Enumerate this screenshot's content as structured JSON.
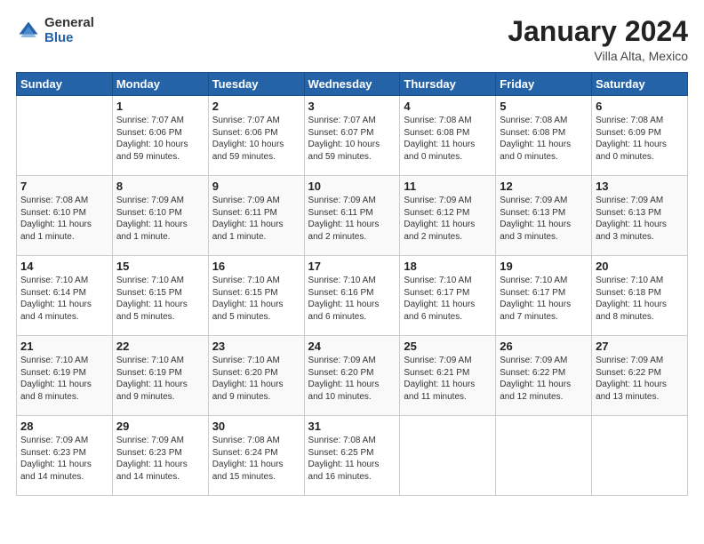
{
  "logo": {
    "general": "General",
    "blue": "Blue"
  },
  "header": {
    "title": "January 2024",
    "subtitle": "Villa Alta, Mexico"
  },
  "columns": [
    "Sunday",
    "Monday",
    "Tuesday",
    "Wednesday",
    "Thursday",
    "Friday",
    "Saturday"
  ],
  "weeks": [
    [
      {
        "day": "",
        "info": ""
      },
      {
        "day": "1",
        "info": "Sunrise: 7:07 AM\nSunset: 6:06 PM\nDaylight: 10 hours\nand 59 minutes."
      },
      {
        "day": "2",
        "info": "Sunrise: 7:07 AM\nSunset: 6:06 PM\nDaylight: 10 hours\nand 59 minutes."
      },
      {
        "day": "3",
        "info": "Sunrise: 7:07 AM\nSunset: 6:07 PM\nDaylight: 10 hours\nand 59 minutes."
      },
      {
        "day": "4",
        "info": "Sunrise: 7:08 AM\nSunset: 6:08 PM\nDaylight: 11 hours\nand 0 minutes."
      },
      {
        "day": "5",
        "info": "Sunrise: 7:08 AM\nSunset: 6:08 PM\nDaylight: 11 hours\nand 0 minutes."
      },
      {
        "day": "6",
        "info": "Sunrise: 7:08 AM\nSunset: 6:09 PM\nDaylight: 11 hours\nand 0 minutes."
      }
    ],
    [
      {
        "day": "7",
        "info": "Sunrise: 7:08 AM\nSunset: 6:10 PM\nDaylight: 11 hours\nand 1 minute."
      },
      {
        "day": "8",
        "info": "Sunrise: 7:09 AM\nSunset: 6:10 PM\nDaylight: 11 hours\nand 1 minute."
      },
      {
        "day": "9",
        "info": "Sunrise: 7:09 AM\nSunset: 6:11 PM\nDaylight: 11 hours\nand 1 minute."
      },
      {
        "day": "10",
        "info": "Sunrise: 7:09 AM\nSunset: 6:11 PM\nDaylight: 11 hours\nand 2 minutes."
      },
      {
        "day": "11",
        "info": "Sunrise: 7:09 AM\nSunset: 6:12 PM\nDaylight: 11 hours\nand 2 minutes."
      },
      {
        "day": "12",
        "info": "Sunrise: 7:09 AM\nSunset: 6:13 PM\nDaylight: 11 hours\nand 3 minutes."
      },
      {
        "day": "13",
        "info": "Sunrise: 7:09 AM\nSunset: 6:13 PM\nDaylight: 11 hours\nand 3 minutes."
      }
    ],
    [
      {
        "day": "14",
        "info": "Sunrise: 7:10 AM\nSunset: 6:14 PM\nDaylight: 11 hours\nand 4 minutes."
      },
      {
        "day": "15",
        "info": "Sunrise: 7:10 AM\nSunset: 6:15 PM\nDaylight: 11 hours\nand 5 minutes."
      },
      {
        "day": "16",
        "info": "Sunrise: 7:10 AM\nSunset: 6:15 PM\nDaylight: 11 hours\nand 5 minutes."
      },
      {
        "day": "17",
        "info": "Sunrise: 7:10 AM\nSunset: 6:16 PM\nDaylight: 11 hours\nand 6 minutes."
      },
      {
        "day": "18",
        "info": "Sunrise: 7:10 AM\nSunset: 6:17 PM\nDaylight: 11 hours\nand 6 minutes."
      },
      {
        "day": "19",
        "info": "Sunrise: 7:10 AM\nSunset: 6:17 PM\nDaylight: 11 hours\nand 7 minutes."
      },
      {
        "day": "20",
        "info": "Sunrise: 7:10 AM\nSunset: 6:18 PM\nDaylight: 11 hours\nand 8 minutes."
      }
    ],
    [
      {
        "day": "21",
        "info": "Sunrise: 7:10 AM\nSunset: 6:19 PM\nDaylight: 11 hours\nand 8 minutes."
      },
      {
        "day": "22",
        "info": "Sunrise: 7:10 AM\nSunset: 6:19 PM\nDaylight: 11 hours\nand 9 minutes."
      },
      {
        "day": "23",
        "info": "Sunrise: 7:10 AM\nSunset: 6:20 PM\nDaylight: 11 hours\nand 9 minutes."
      },
      {
        "day": "24",
        "info": "Sunrise: 7:09 AM\nSunset: 6:20 PM\nDaylight: 11 hours\nand 10 minutes."
      },
      {
        "day": "25",
        "info": "Sunrise: 7:09 AM\nSunset: 6:21 PM\nDaylight: 11 hours\nand 11 minutes."
      },
      {
        "day": "26",
        "info": "Sunrise: 7:09 AM\nSunset: 6:22 PM\nDaylight: 11 hours\nand 12 minutes."
      },
      {
        "day": "27",
        "info": "Sunrise: 7:09 AM\nSunset: 6:22 PM\nDaylight: 11 hours\nand 13 minutes."
      }
    ],
    [
      {
        "day": "28",
        "info": "Sunrise: 7:09 AM\nSunset: 6:23 PM\nDaylight: 11 hours\nand 14 minutes."
      },
      {
        "day": "29",
        "info": "Sunrise: 7:09 AM\nSunset: 6:23 PM\nDaylight: 11 hours\nand 14 minutes."
      },
      {
        "day": "30",
        "info": "Sunrise: 7:08 AM\nSunset: 6:24 PM\nDaylight: 11 hours\nand 15 minutes."
      },
      {
        "day": "31",
        "info": "Sunrise: 7:08 AM\nSunset: 6:25 PM\nDaylight: 11 hours\nand 16 minutes."
      },
      {
        "day": "",
        "info": ""
      },
      {
        "day": "",
        "info": ""
      },
      {
        "day": "",
        "info": ""
      }
    ]
  ]
}
